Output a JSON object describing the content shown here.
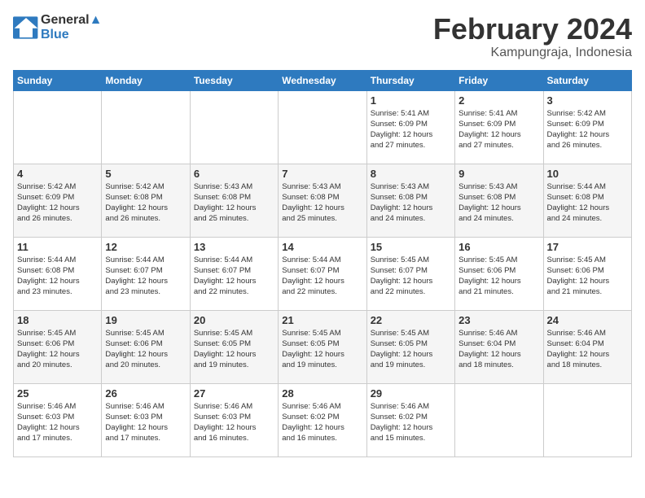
{
  "header": {
    "logo_line1": "General",
    "logo_line2": "Blue",
    "month_title": "February 2024",
    "location": "Kampungraja, Indonesia"
  },
  "days_of_week": [
    "Sunday",
    "Monday",
    "Tuesday",
    "Wednesday",
    "Thursday",
    "Friday",
    "Saturday"
  ],
  "weeks": [
    [
      {
        "day": "",
        "info": ""
      },
      {
        "day": "",
        "info": ""
      },
      {
        "day": "",
        "info": ""
      },
      {
        "day": "",
        "info": ""
      },
      {
        "day": "1",
        "info": "Sunrise: 5:41 AM\nSunset: 6:09 PM\nDaylight: 12 hours\nand 27 minutes."
      },
      {
        "day": "2",
        "info": "Sunrise: 5:41 AM\nSunset: 6:09 PM\nDaylight: 12 hours\nand 27 minutes."
      },
      {
        "day": "3",
        "info": "Sunrise: 5:42 AM\nSunset: 6:09 PM\nDaylight: 12 hours\nand 26 minutes."
      }
    ],
    [
      {
        "day": "4",
        "info": "Sunrise: 5:42 AM\nSunset: 6:09 PM\nDaylight: 12 hours\nand 26 minutes."
      },
      {
        "day": "5",
        "info": "Sunrise: 5:42 AM\nSunset: 6:08 PM\nDaylight: 12 hours\nand 26 minutes."
      },
      {
        "day": "6",
        "info": "Sunrise: 5:43 AM\nSunset: 6:08 PM\nDaylight: 12 hours\nand 25 minutes."
      },
      {
        "day": "7",
        "info": "Sunrise: 5:43 AM\nSunset: 6:08 PM\nDaylight: 12 hours\nand 25 minutes."
      },
      {
        "day": "8",
        "info": "Sunrise: 5:43 AM\nSunset: 6:08 PM\nDaylight: 12 hours\nand 24 minutes."
      },
      {
        "day": "9",
        "info": "Sunrise: 5:43 AM\nSunset: 6:08 PM\nDaylight: 12 hours\nand 24 minutes."
      },
      {
        "day": "10",
        "info": "Sunrise: 5:44 AM\nSunset: 6:08 PM\nDaylight: 12 hours\nand 24 minutes."
      }
    ],
    [
      {
        "day": "11",
        "info": "Sunrise: 5:44 AM\nSunset: 6:08 PM\nDaylight: 12 hours\nand 23 minutes."
      },
      {
        "day": "12",
        "info": "Sunrise: 5:44 AM\nSunset: 6:07 PM\nDaylight: 12 hours\nand 23 minutes."
      },
      {
        "day": "13",
        "info": "Sunrise: 5:44 AM\nSunset: 6:07 PM\nDaylight: 12 hours\nand 22 minutes."
      },
      {
        "day": "14",
        "info": "Sunrise: 5:44 AM\nSunset: 6:07 PM\nDaylight: 12 hours\nand 22 minutes."
      },
      {
        "day": "15",
        "info": "Sunrise: 5:45 AM\nSunset: 6:07 PM\nDaylight: 12 hours\nand 22 minutes."
      },
      {
        "day": "16",
        "info": "Sunrise: 5:45 AM\nSunset: 6:06 PM\nDaylight: 12 hours\nand 21 minutes."
      },
      {
        "day": "17",
        "info": "Sunrise: 5:45 AM\nSunset: 6:06 PM\nDaylight: 12 hours\nand 21 minutes."
      }
    ],
    [
      {
        "day": "18",
        "info": "Sunrise: 5:45 AM\nSunset: 6:06 PM\nDaylight: 12 hours\nand 20 minutes."
      },
      {
        "day": "19",
        "info": "Sunrise: 5:45 AM\nSunset: 6:06 PM\nDaylight: 12 hours\nand 20 minutes."
      },
      {
        "day": "20",
        "info": "Sunrise: 5:45 AM\nSunset: 6:05 PM\nDaylight: 12 hours\nand 19 minutes."
      },
      {
        "day": "21",
        "info": "Sunrise: 5:45 AM\nSunset: 6:05 PM\nDaylight: 12 hours\nand 19 minutes."
      },
      {
        "day": "22",
        "info": "Sunrise: 5:45 AM\nSunset: 6:05 PM\nDaylight: 12 hours\nand 19 minutes."
      },
      {
        "day": "23",
        "info": "Sunrise: 5:46 AM\nSunset: 6:04 PM\nDaylight: 12 hours\nand 18 minutes."
      },
      {
        "day": "24",
        "info": "Sunrise: 5:46 AM\nSunset: 6:04 PM\nDaylight: 12 hours\nand 18 minutes."
      }
    ],
    [
      {
        "day": "25",
        "info": "Sunrise: 5:46 AM\nSunset: 6:03 PM\nDaylight: 12 hours\nand 17 minutes."
      },
      {
        "day": "26",
        "info": "Sunrise: 5:46 AM\nSunset: 6:03 PM\nDaylight: 12 hours\nand 17 minutes."
      },
      {
        "day": "27",
        "info": "Sunrise: 5:46 AM\nSunset: 6:03 PM\nDaylight: 12 hours\nand 16 minutes."
      },
      {
        "day": "28",
        "info": "Sunrise: 5:46 AM\nSunset: 6:02 PM\nDaylight: 12 hours\nand 16 minutes."
      },
      {
        "day": "29",
        "info": "Sunrise: 5:46 AM\nSunset: 6:02 PM\nDaylight: 12 hours\nand 15 minutes."
      },
      {
        "day": "",
        "info": ""
      },
      {
        "day": "",
        "info": ""
      }
    ]
  ]
}
